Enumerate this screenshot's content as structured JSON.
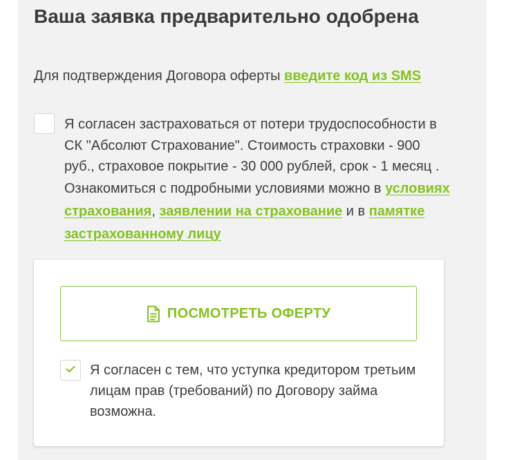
{
  "title": "Ваша заявка предварительно одобрена",
  "sms": {
    "prefix": "Для подтверждения Договора оферты ",
    "link": "введите код из SMS"
  },
  "insurance": {
    "checked": false,
    "text_1": "Я согласен застраховаться от потери трудоспособности в СК \"Абсолют Страхование\". Стоимость страховки - 900 руб., страховое покрытие - 30 000 рублей, срок - 1 месяц . Ознакомиться с подробными условиями можно в ",
    "link_terms": "условиях страхования",
    "sep_1": ", ",
    "link_application": "заявлении на страхование",
    "sep_2": " и в ",
    "link_memo": "памятке застрахованному лицу"
  },
  "offer": {
    "button_label": "ПОСМОТРЕТЬ ОФЕРТУ",
    "icon": "document-icon"
  },
  "assignment": {
    "checked": true,
    "text": "Я согласен с тем, что уступка кредитором третьим лицам прав (требований) по Договору займа возможна."
  },
  "colors": {
    "accent": "#84c21e",
    "panel_bg": "#f2f2f2",
    "text": "#3d3d3d"
  }
}
